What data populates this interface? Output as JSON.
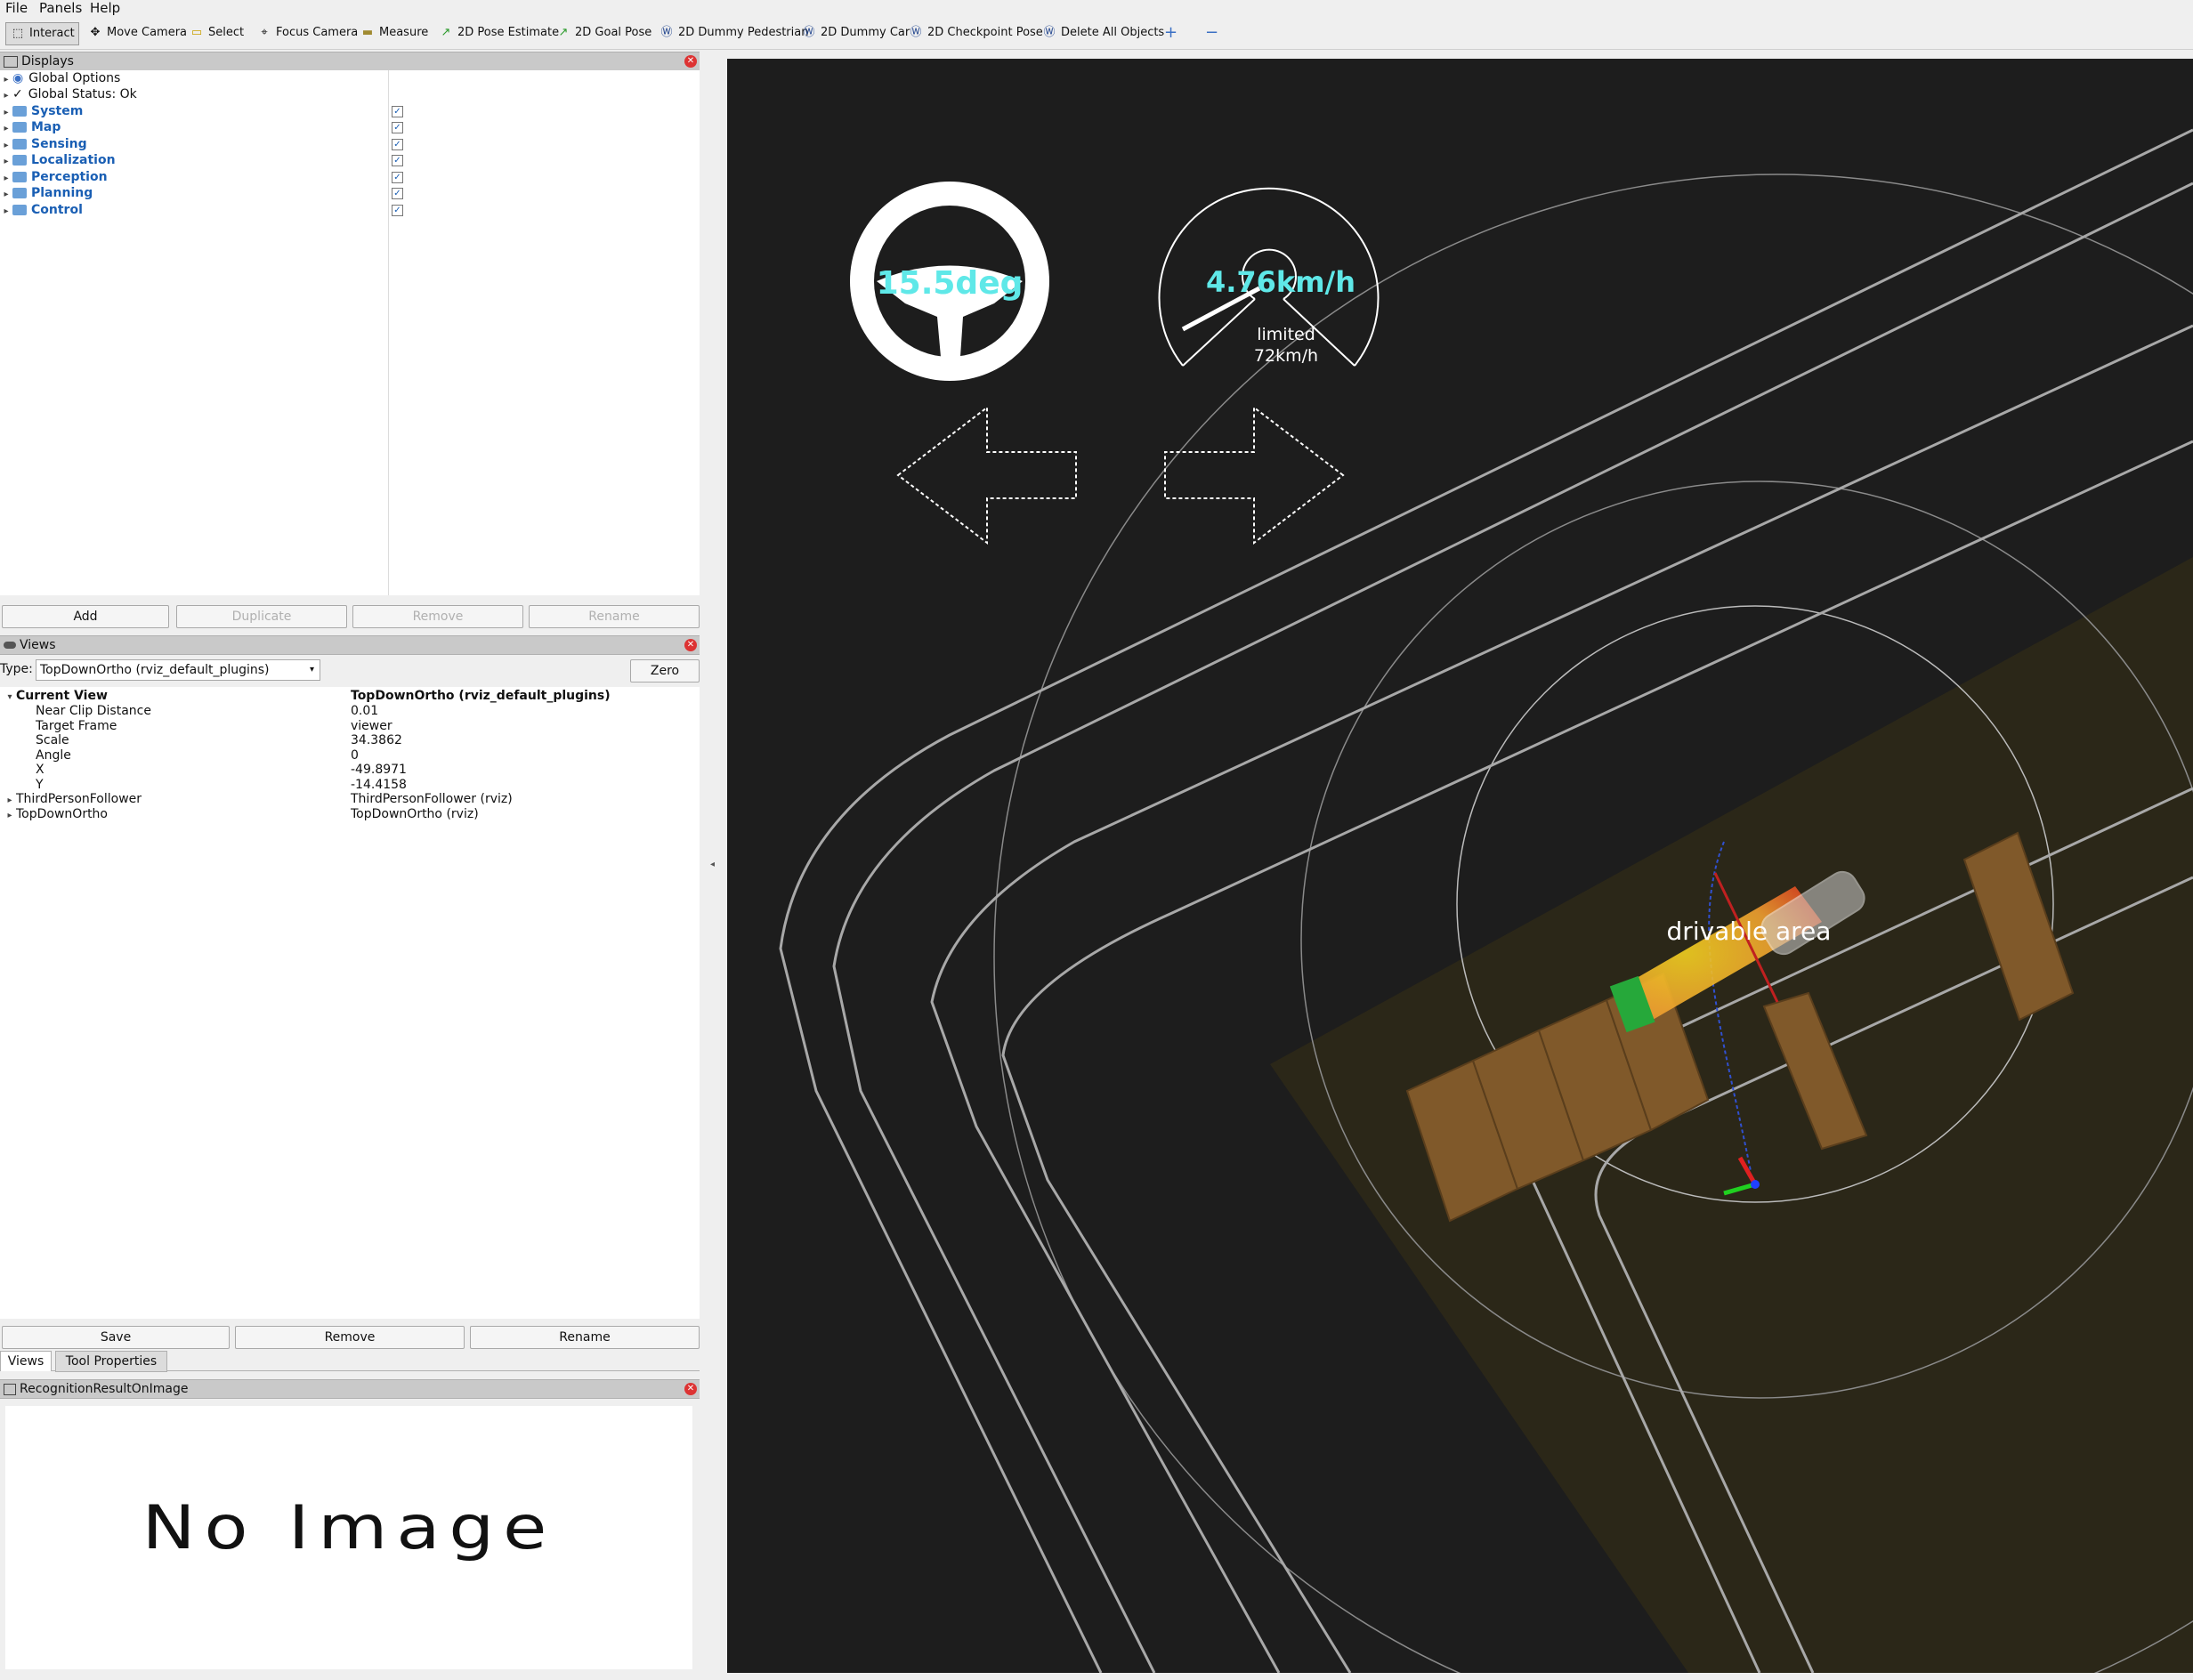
{
  "menu": [
    "File",
    "Panels",
    "Help"
  ],
  "toolbar": {
    "tools": [
      {
        "label": "Interact",
        "icon": "cursor-icon",
        "active": true
      },
      {
        "label": "Move Camera",
        "icon": "move-camera-icon"
      },
      {
        "label": "Select",
        "icon": "select-icon"
      },
      {
        "label": "Focus Camera",
        "icon": "focus-camera-icon"
      },
      {
        "label": "Measure",
        "icon": "measure-icon"
      },
      {
        "label": "2D Pose Estimate",
        "icon": "pose-estimate-icon"
      },
      {
        "label": "2D Goal Pose",
        "icon": "goal-pose-icon"
      },
      {
        "label": "2D Dummy Pedestrian",
        "icon": "autoware-logo-icon"
      },
      {
        "label": "2D Dummy Car",
        "icon": "autoware-logo-icon"
      },
      {
        "label": "2D Checkpoint Pose",
        "icon": "autoware-logo-icon"
      },
      {
        "label": "Delete All Objects",
        "icon": "autoware-logo-icon"
      }
    ],
    "add_icon": "plus-icon",
    "remove_icon": "minus-icon"
  },
  "displays": {
    "title": "Displays",
    "items": [
      {
        "label": "Global Options",
        "icon": "globe-icon",
        "group": false
      },
      {
        "label": "Global Status: Ok",
        "icon": "check-icon",
        "group": false
      },
      {
        "label": "System",
        "group": true,
        "checked": true
      },
      {
        "label": "Map",
        "group": true,
        "checked": true
      },
      {
        "label": "Sensing",
        "group": true,
        "checked": true
      },
      {
        "label": "Localization",
        "group": true,
        "checked": true
      },
      {
        "label": "Perception",
        "group": true,
        "checked": true
      },
      {
        "label": "Planning",
        "group": true,
        "checked": true
      },
      {
        "label": "Control",
        "group": true,
        "checked": true
      }
    ],
    "buttons": {
      "add": "Add",
      "duplicate": "Duplicate",
      "remove": "Remove",
      "rename": "Rename"
    }
  },
  "views": {
    "title": "Views",
    "type_label": "Type:",
    "type_value": "TopDownOrtho (rviz_default_plugins)",
    "zero_button": "Zero",
    "current_view": {
      "label": "Current View",
      "value": "TopDownOrtho (rviz_default_plugins)"
    },
    "properties": [
      {
        "name": "Near Clip Distance",
        "value": "0.01"
      },
      {
        "name": "Target Frame",
        "value": "viewer"
      },
      {
        "name": "Scale",
        "value": "34.3862"
      },
      {
        "name": "Angle",
        "value": "0"
      },
      {
        "name": "X",
        "value": "-49.8971"
      },
      {
        "name": "Y",
        "value": "-14.4158"
      }
    ],
    "saved": [
      {
        "name": "ThirdPersonFollower",
        "value": "ThirdPersonFollower (rviz)"
      },
      {
        "name": "TopDownOrtho",
        "value": "TopDownOrtho (rviz)"
      }
    ],
    "buttons": {
      "save": "Save",
      "remove": "Remove",
      "rename": "Rename"
    },
    "tabs": [
      "Views",
      "Tool Properties"
    ]
  },
  "recognition": {
    "title": "RecognitionResultOnImage",
    "image_text": "No Image"
  },
  "overlay": {
    "steering": "15.5deg",
    "speed": "4.76km/h",
    "limit_label": "limited",
    "limit_value": "72km/h",
    "area_label": "drivable  area",
    "accent_color": "#5fe8e8"
  }
}
